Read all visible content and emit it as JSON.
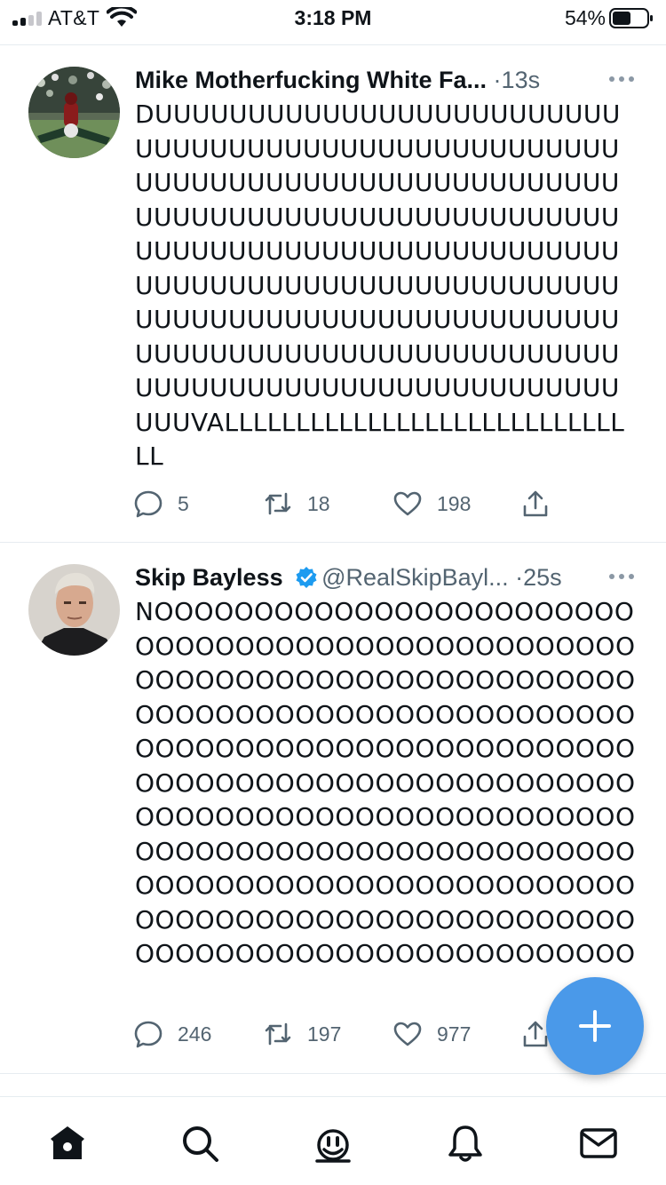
{
  "status_bar": {
    "carrier": "AT&T",
    "time": "3:18 PM",
    "battery_percent": "54%",
    "signal_bars": 2,
    "battery_level": 0.54
  },
  "colors": {
    "accent": "#1d9bf0",
    "fab": "#4a99e9",
    "text_primary": "#0f1419",
    "text_secondary": "#536471"
  },
  "tweets": [
    {
      "author": "Mike Motherfucking White Fa...",
      "handle": "",
      "verified": false,
      "separator": "·",
      "time": "13s",
      "body": "DUUUUUUUUUUUUUUUUUUUUUUUUUUUUUUUUUUUUUUUUUUUUUUUUUUUUUUUUUUUUUUUUUUUUUUUUUUUUUUUUUUUUUUUUUUUUUUUUUUUUUUUUUUUUUUUUUUUUUUUUUUUUUUUUUUUUUUUUUUUUUUUUUUUUUUUUUUUUUUUUUUUUUUUUUUUUUUUUUUUUUUUUUUUUUUUUUUUUUUUUUUUUUUUUUUUUUUUUUUUUUUUUUUUUUUUUUUUUVALLLLLLLLLLLLLLLLLLLLLLLLLLLLLL",
      "replies": "5",
      "retweets": "18",
      "likes": "198",
      "avatar_icon": "football-player-avatar"
    },
    {
      "author": "Skip Bayless",
      "handle": "@RealSkipBayl...",
      "verified": true,
      "separator": "·",
      "time": "25s",
      "body": "NOOOOOOOOOOOOOOOOOOOOOOOOOOOOOOOOOOOOOOOOOOOOOOOOOOOOOOOOOOOOOOOOOOOOOOOOOOOOOOOOOOOOOOOOOOOOOOOOOOOOOOOOOOOOOOOOOOOOOOOOOOOOOOOOOOOOOOOOOOOOOOOOOOOOOOOOOOOOOOOOOOOOOOOOOOOOOOOOOOOOOOOOOOOOOOOOOOOOOOOOOOOOOOOOOOOOOOOOOOOOOOOOOOOOOOOOOOOOOOOOOOOOOOOOOOOOOOOOOOOOOOOOOOOOOOOOOO",
      "replies": "246",
      "retweets": "197",
      "likes": "977",
      "avatar_icon": "man-portrait-avatar"
    }
  ],
  "tab_bar": {
    "items": [
      "home-icon",
      "search-icon",
      "spaces-icon",
      "notifications-icon",
      "messages-icon"
    ]
  },
  "fab": {
    "icon": "plus-icon"
  }
}
